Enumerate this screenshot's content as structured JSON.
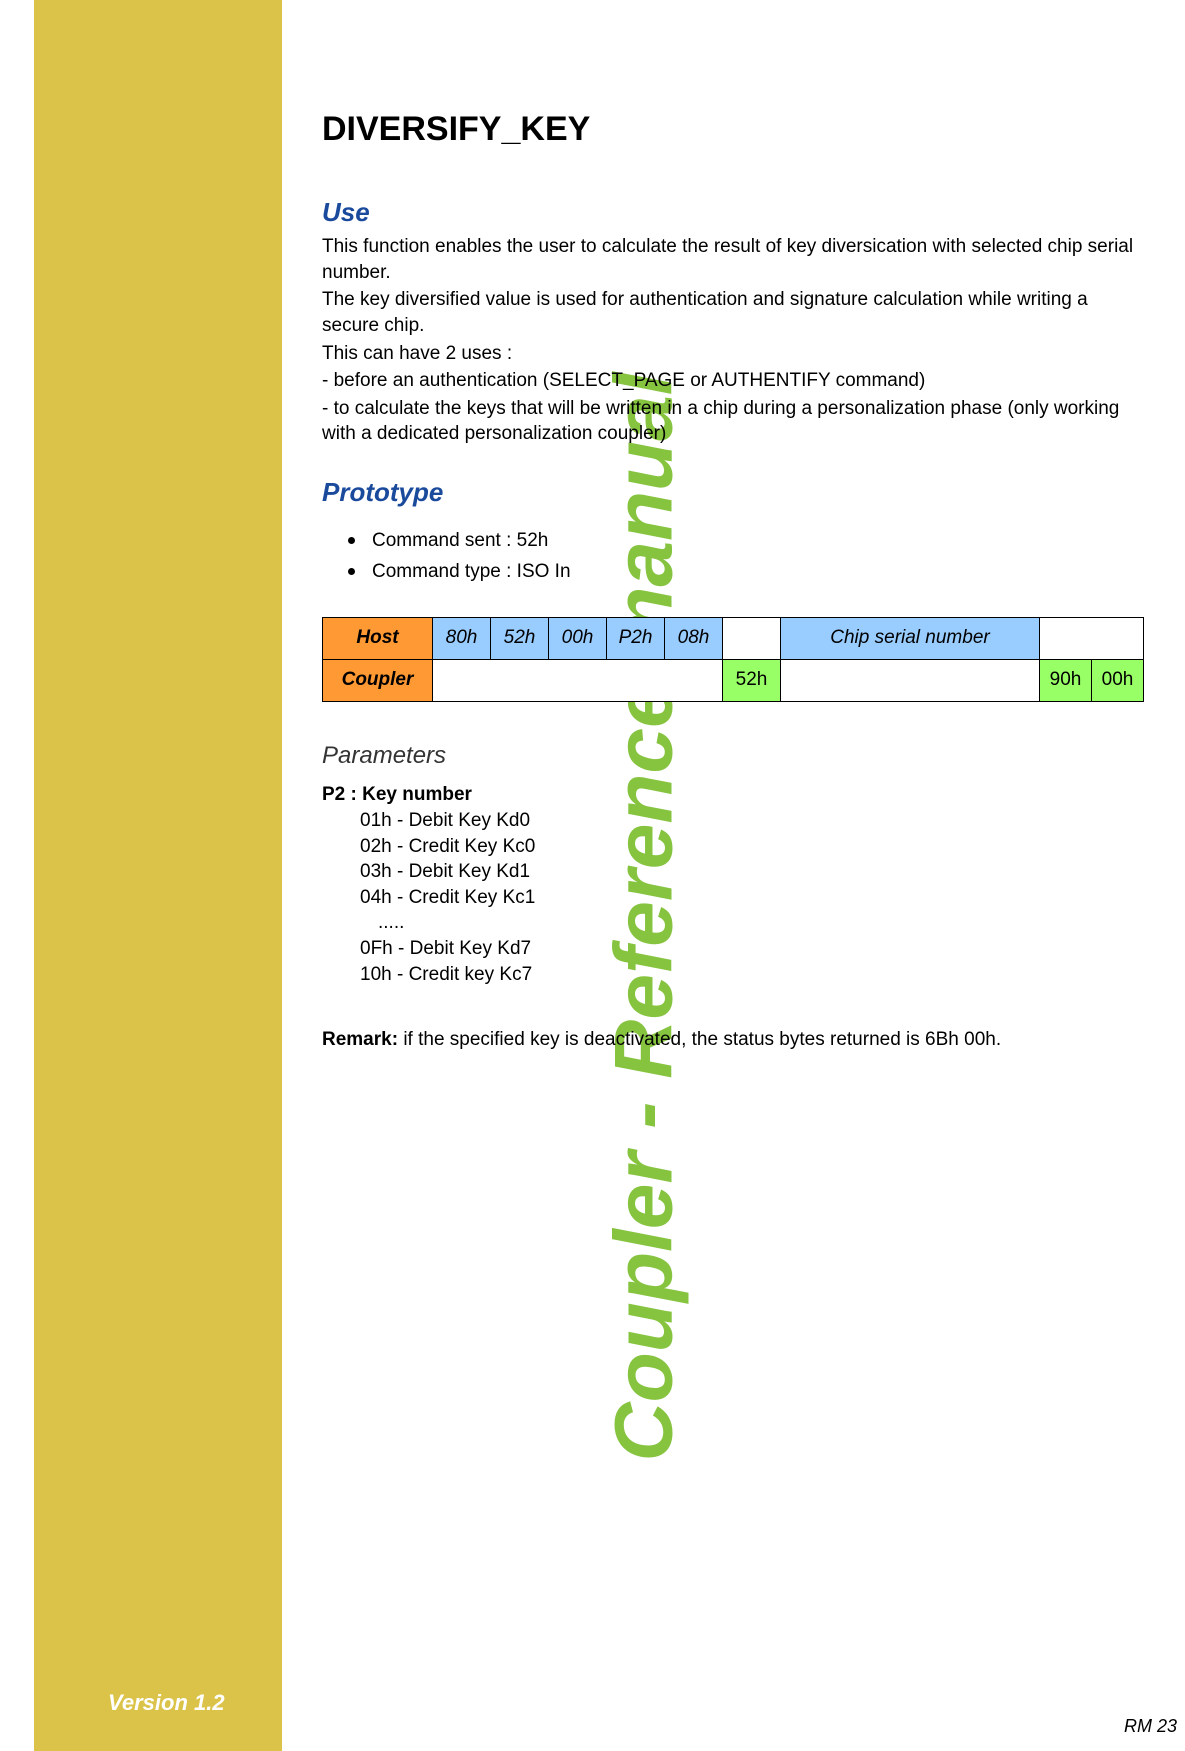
{
  "sidebar": {
    "vertical_title": "Coupler - Reference manual",
    "version": "Version 1.2"
  },
  "page": {
    "title": "DIVERSIFY_KEY",
    "number": "RM 23"
  },
  "use": {
    "heading": "Use",
    "p1": "This function enables the user to calculate the result of key diversication with selected chip serial number.",
    "p2": "The key diversified value is used for authentication and signature calculation while writing a secure chip.",
    "p3": "This can have 2 uses :",
    "p4": "- before an authentication (SELECT_PAGE or AUTHENTIFY command)",
    "p5": "- to calculate the keys that will be written in a chip during a personalization phase (only working with a dedicated personalization coupler)"
  },
  "prototype": {
    "heading": "Prototype",
    "bullet1": "Command sent : 52h",
    "bullet2": "Command type : ISO In",
    "table": {
      "host_label": "Host",
      "coupler_label": "Coupler",
      "host_row": {
        "c1": "80h",
        "c2": "52h",
        "c3": "00h",
        "c4": "P2h",
        "c5": "08h",
        "chip": "Chip serial number"
      },
      "coupler_row": {
        "resp": "52h",
        "sw1": "90h",
        "sw2": "00h"
      }
    }
  },
  "parameters": {
    "heading": "Parameters",
    "label": "P2 : Key number",
    "lines": {
      "l1": "01h - Debit Key Kd0",
      "l2": "02h - Credit Key Kc0",
      "l3": "03h - Debit Key Kd1",
      "l4": "04h - Credit Key Kc1",
      "l5": ".....",
      "l6": "0Fh - Debit Key Kd7",
      "l7": "10h - Credit key Kc7"
    }
  },
  "remark": {
    "label": "Remark:",
    "text": " if the specified key is deactivated, the status bytes returned is 6Bh 00h."
  }
}
